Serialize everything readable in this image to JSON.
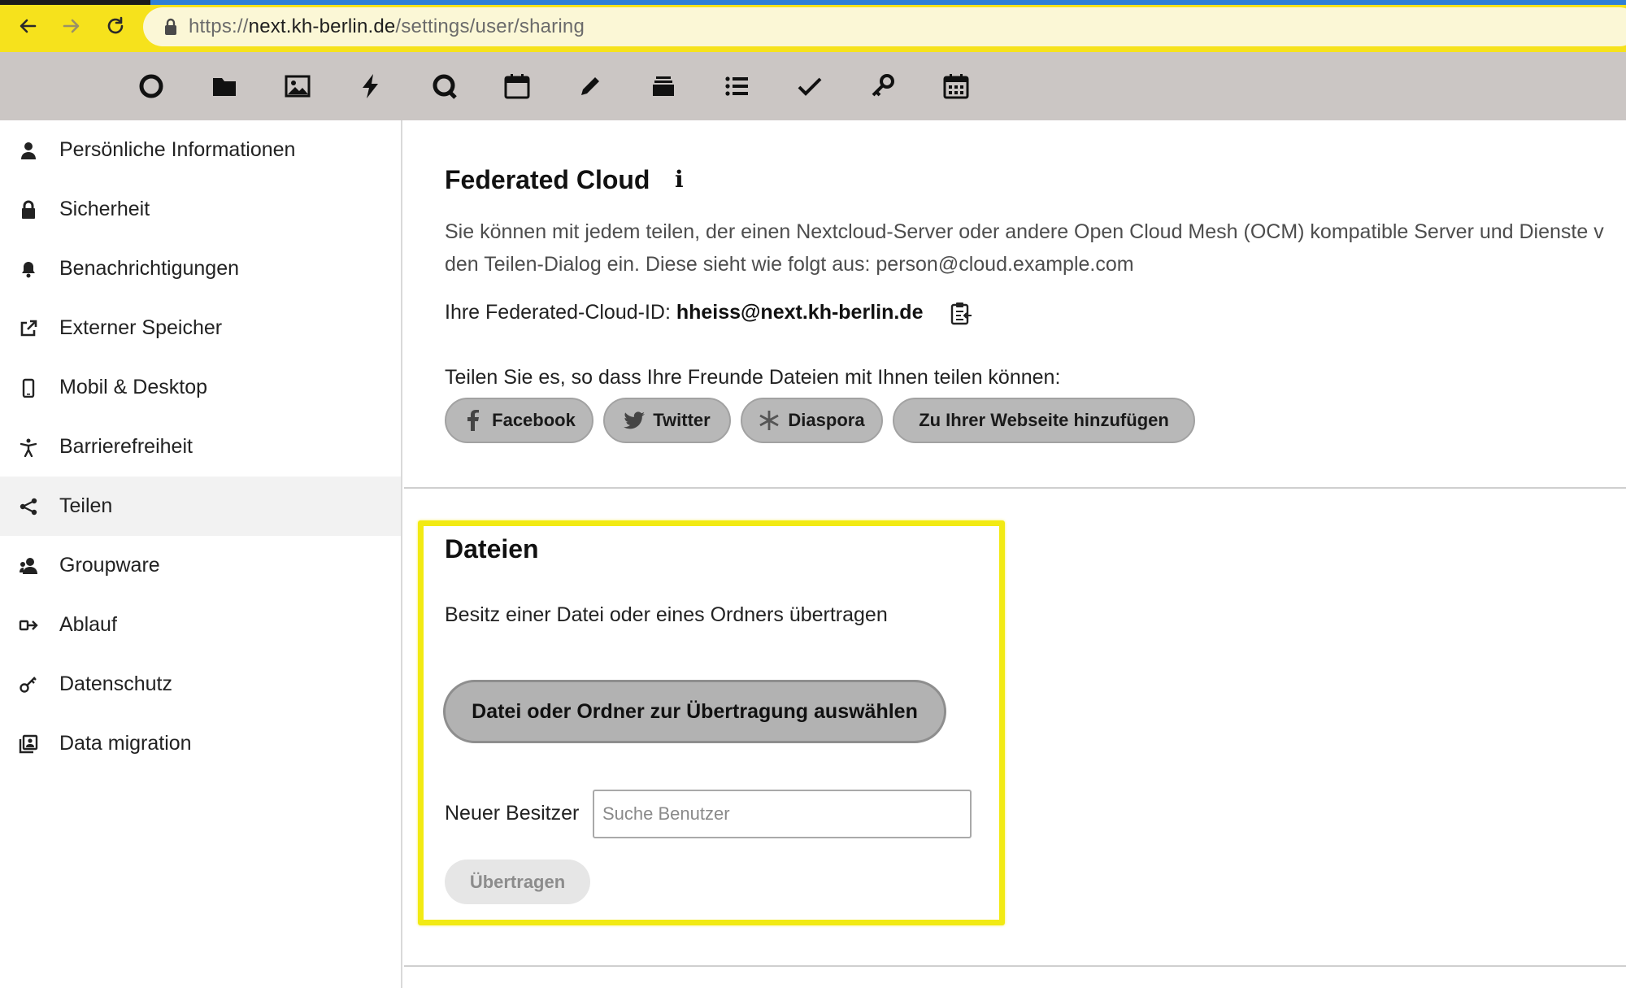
{
  "browser": {
    "url_scheme": "https://",
    "url_host": "next.kh-berlin.de",
    "url_path": "/settings/user/sharing"
  },
  "app_toolbar": {
    "icons": [
      "dashboard-icon",
      "files-icon",
      "photos-icon",
      "activity-icon",
      "talk-icon",
      "calendar-icon",
      "notes-icon",
      "deck-icon",
      "tasks-list-icon",
      "tasks-check-icon",
      "passwords-icon",
      "calendar-grid-icon"
    ]
  },
  "sidebar": {
    "items": [
      {
        "label": "Persönliche Informationen",
        "icon": "person-icon"
      },
      {
        "label": "Sicherheit",
        "icon": "lock-icon"
      },
      {
        "label": "Benachrichtigungen",
        "icon": "bell-icon"
      },
      {
        "label": "Externer Speicher",
        "icon": "external-link-icon"
      },
      {
        "label": "Mobil & Desktop",
        "icon": "phone-icon"
      },
      {
        "label": "Barrierefreiheit",
        "icon": "accessibility-icon"
      },
      {
        "label": "Teilen",
        "icon": "share-icon",
        "active": true
      },
      {
        "label": "Groupware",
        "icon": "group-icon"
      },
      {
        "label": "Ablauf",
        "icon": "flow-icon"
      },
      {
        "label": "Datenschutz",
        "icon": "key-icon"
      },
      {
        "label": "Data migration",
        "icon": "migration-icon"
      }
    ]
  },
  "federated": {
    "title": "Federated Cloud",
    "info": "i",
    "description_line1": "Sie können mit jedem teilen, der einen Nextcloud-Server oder andere Open Cloud Mesh (OCM) kompatible Server und Dienste v",
    "description_line2": "den Teilen-Dialog ein. Diese sieht wie folgt aus: person@cloud.example.com",
    "id_label": "Ihre Federated-Cloud-ID:",
    "id_value": "hheiss@next.kh-berlin.de",
    "share_prompt": "Teilen Sie es, so dass Ihre Freunde Dateien mit Ihnen teilen können:",
    "buttons": {
      "facebook": "Facebook",
      "twitter": "Twitter",
      "diaspora": "Diaspora",
      "website": "Zu Ihrer Webseite hinzufügen"
    }
  },
  "files": {
    "title": "Dateien",
    "subtitle": "Besitz einer Datei oder eines Ordners übertragen",
    "select_button": "Datei oder Ordner zur Übertragung auswählen",
    "new_owner_label": "Neuer Besitzer",
    "new_owner_placeholder": "Suche Benutzer",
    "new_owner_value": "",
    "transfer_button": "Übertragen"
  },
  "colors": {
    "browser_bar": "#f6e21c",
    "app_toolbar": "#cbc6c4",
    "highlight": "#f2ea13",
    "pill_button": "#b8b8b8"
  }
}
